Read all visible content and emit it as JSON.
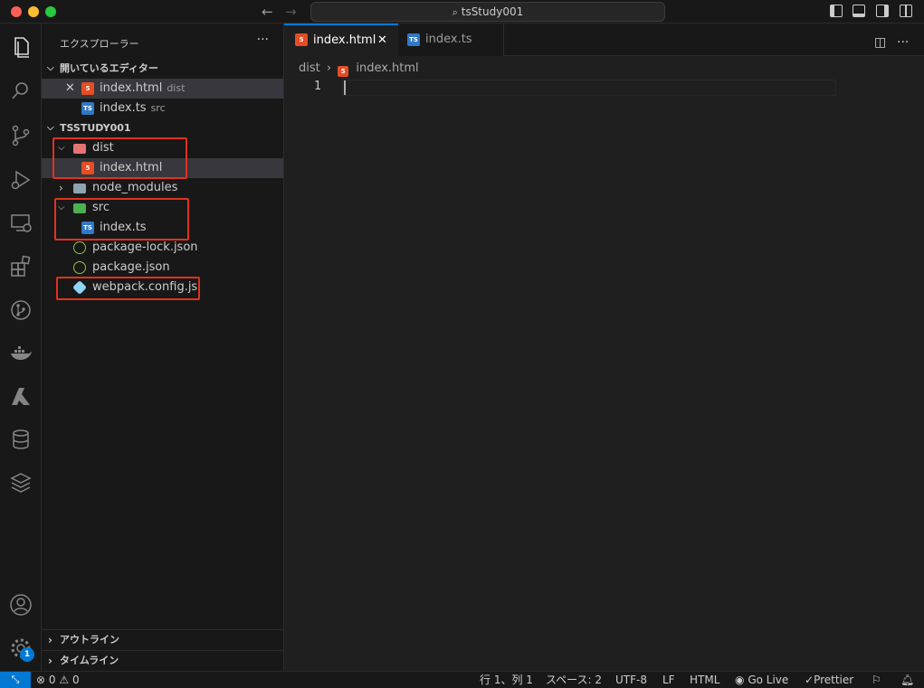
{
  "window": {
    "title": "tsStudy001"
  },
  "sidebar": {
    "title": "エクスプローラー",
    "open_editors": {
      "title": "開いているエディター",
      "items": [
        {
          "name": "index.html",
          "desc": "dist",
          "icon": "html-file-icon"
        },
        {
          "name": "index.ts",
          "desc": "src",
          "icon": "ts-file-icon"
        }
      ]
    },
    "project": {
      "title": "TSSTUDY001",
      "items": [
        {
          "name": "dist",
          "type": "folder",
          "expanded": true
        },
        {
          "name": "index.html",
          "type": "file"
        },
        {
          "name": "node_modules",
          "type": "folder",
          "expanded": false
        },
        {
          "name": "src",
          "type": "folder",
          "expanded": true
        },
        {
          "name": "index.ts",
          "type": "file"
        },
        {
          "name": "package-lock.json",
          "type": "file"
        },
        {
          "name": "package.json",
          "type": "file"
        },
        {
          "name": "webpack.config.js",
          "type": "file"
        }
      ]
    },
    "outline_title": "アウトライン",
    "timeline_title": "タイムライン"
  },
  "tabs": [
    {
      "label": "index.html",
      "active": true
    },
    {
      "label": "index.ts",
      "active": false
    }
  ],
  "breadcrumb": {
    "folder": "dist",
    "file": "index.html"
  },
  "editor": {
    "line_number": "1"
  },
  "activity": {
    "settings_badge": "1"
  },
  "statusbar": {
    "errors": "0",
    "warnings": "0",
    "position": "行 1、列 1",
    "indent": "スペース: 2",
    "encoding": "UTF-8",
    "eol": "LF",
    "language": "HTML",
    "golive": "Go Live",
    "prettier": "Prettier"
  },
  "colors": {
    "accent": "#0078d4",
    "highlight": "#e0321e",
    "html": "#e44d26",
    "ts": "#3178c6"
  }
}
